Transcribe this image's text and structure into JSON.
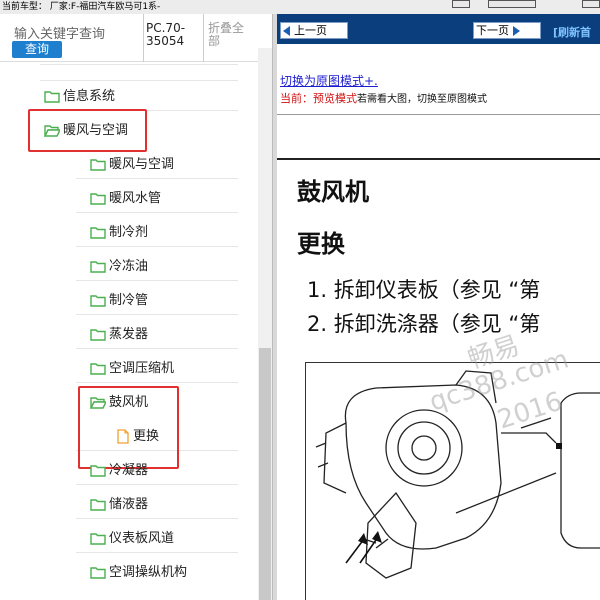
{
  "topbar": {
    "text": "当前车型： 厂家:F-福田汽车欧马可1系-"
  },
  "search": {
    "placeholder": "输入关键字查询",
    "button": "查询",
    "code": "PC.70-35054",
    "fold": "折叠全部"
  },
  "tree": {
    "items": [
      {
        "label": "信息系统",
        "icon": "folder-green",
        "level": 1
      },
      {
        "label": "暖风与空调",
        "icon": "folder-open-green",
        "level": 1
      },
      {
        "label": "暖风与空调",
        "icon": "folder-green",
        "level": 2
      },
      {
        "label": "暖风水管",
        "icon": "folder-green",
        "level": 2
      },
      {
        "label": "制冷剂",
        "icon": "folder-green",
        "level": 2
      },
      {
        "label": "冷冻油",
        "icon": "folder-green",
        "level": 2
      },
      {
        "label": "制冷管",
        "icon": "folder-green",
        "level": 2
      },
      {
        "label": "蒸发器",
        "icon": "folder-green",
        "level": 2
      },
      {
        "label": "空调压缩机",
        "icon": "folder-green",
        "level": 2
      },
      {
        "label": "鼓风机",
        "icon": "folder-open-green",
        "level": 2
      },
      {
        "label": "更换",
        "icon": "document-orange",
        "level": 3
      },
      {
        "label": "冷凝器",
        "icon": "folder-green",
        "level": 2
      },
      {
        "label": "储液器",
        "icon": "folder-green",
        "level": 2
      },
      {
        "label": "仪表板风道",
        "icon": "folder-green",
        "level": 2
      },
      {
        "label": "空调操纵机构",
        "icon": "folder-green",
        "level": 2
      }
    ]
  },
  "nav": {
    "prev": "上一页",
    "next": "下一页",
    "refresh": "[刷新首"
  },
  "content": {
    "switch_link": "切换为原图模式+.",
    "current_label": "当前：预览模式",
    "current_hint": "若需看大图，切换至原图模式",
    "title": "鼓风机",
    "subtitle": "更换",
    "step1": "1. 拆卸仪表板（参见 “第",
    "step2": "2. 拆卸洗涤器（参见 “第",
    "watermark1": "畅易",
    "watermark2": "qc388.com",
    "watermark3": "2016"
  },
  "colors": {
    "nav_bg": "#0a3e7c",
    "highlight": "#e03030",
    "folder": "#4caf50",
    "doc": "#f0a030",
    "link": "#1d1dd0"
  }
}
